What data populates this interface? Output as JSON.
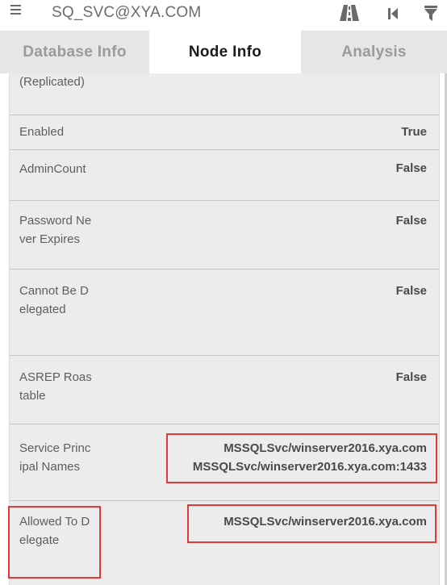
{
  "header": {
    "title": "SQ_SVC@XYA.COM",
    "icons": [
      "menu-icon",
      "road-icon",
      "skip-back-icon",
      "filter-icon"
    ]
  },
  "tabs": [
    {
      "label": "Database Info",
      "active": false
    },
    {
      "label": "Node Info",
      "active": true
    },
    {
      "label": "Analysis",
      "active": false
    }
  ],
  "rows": [
    {
      "label": "(Replicated)",
      "value": ""
    },
    {
      "label": "Enabled",
      "value": "True"
    },
    {
      "label": "AdminCount",
      "value": "False"
    },
    {
      "label": "Password Never Expires",
      "value": "False"
    },
    {
      "label": "Cannot Be Delegated",
      "value": "False"
    },
    {
      "label": "ASREP Roastable",
      "value": "False"
    },
    {
      "label": "Service Principal Names",
      "values": [
        "MSSQLSvc/winserver2016.xya.com",
        "MSSQLSvc/winserver2016.xya.com:1433"
      ]
    },
    {
      "label": "Allowed To Delegate",
      "value": "MSSQLSvc/winserver2016.xya.com"
    }
  ],
  "colors": {
    "highlight": "#e53935",
    "panel_bg": "#ececec",
    "tab_inactive_bg": "#e6e6e6"
  }
}
